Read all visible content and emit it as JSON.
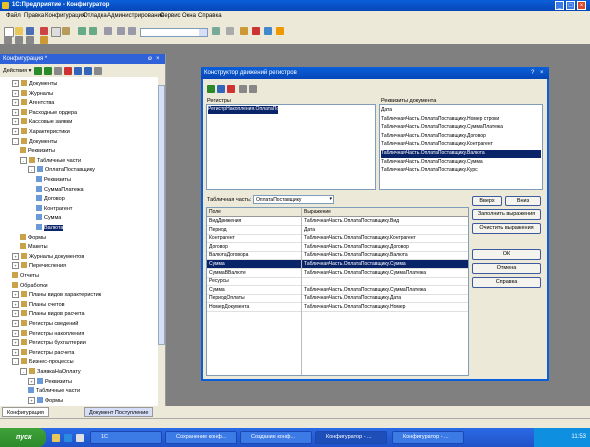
{
  "window": {
    "title": "1С:Предприятие - Конфигуратор"
  },
  "menu": [
    "Файл",
    "Правка",
    "Конфигурация",
    "Отладка",
    "Администрирование",
    "Сервис",
    "Окна",
    "Справка"
  ],
  "config_panel": {
    "title": "Конфигурация *",
    "actions_label": "Действия ▾",
    "tree": [
      {
        "label": "Документы",
        "level": 1,
        "pm": "+"
      },
      {
        "label": "Журналы",
        "level": 1,
        "pm": "+"
      },
      {
        "label": "Агентства",
        "level": 1,
        "pm": "+"
      },
      {
        "label": "Расходные ордера",
        "level": 1,
        "pm": "+"
      },
      {
        "label": "Кассовые заявки",
        "level": 1,
        "pm": "+"
      },
      {
        "label": "Характеристики",
        "level": 1,
        "pm": "+"
      },
      {
        "label": "Документы",
        "level": 1,
        "pm": "-"
      },
      {
        "label": "Реквизиты",
        "level": 2,
        "pm": ""
      },
      {
        "label": "Табличные части",
        "level": 2,
        "pm": "-"
      },
      {
        "label": "ОплатаПоставщику",
        "level": 3,
        "pm": "-"
      },
      {
        "label": "Реквизиты",
        "level": 4,
        "pm": ""
      },
      {
        "label": "СуммаПлатежа",
        "level": 4,
        "pm": ""
      },
      {
        "label": "Договор",
        "level": 4,
        "pm": ""
      },
      {
        "label": "Контрагент",
        "level": 4,
        "pm": ""
      },
      {
        "label": "Сумма",
        "level": 4,
        "pm": ""
      },
      {
        "label": "Валюта",
        "level": 4,
        "pm": "",
        "selected": true
      },
      {
        "label": "Формы",
        "level": 2,
        "pm": ""
      },
      {
        "label": "Макеты",
        "level": 2,
        "pm": ""
      },
      {
        "label": "Журналы документов",
        "level": 1,
        "pm": "+"
      },
      {
        "label": "Перечисления",
        "level": 1,
        "pm": "+"
      },
      {
        "label": "Отчеты",
        "level": 1,
        "pm": ""
      },
      {
        "label": "Обработки",
        "level": 1,
        "pm": ""
      },
      {
        "label": "Планы видов характеристик",
        "level": 1,
        "pm": "+"
      },
      {
        "label": "Планы счетов",
        "level": 1,
        "pm": "+"
      },
      {
        "label": "Планы видов расчета",
        "level": 1,
        "pm": "+"
      },
      {
        "label": "Регистры сведений",
        "level": 1,
        "pm": "+"
      },
      {
        "label": "Регистры накопления",
        "level": 1,
        "pm": "+"
      },
      {
        "label": "Регистры бухгалтерии",
        "level": 1,
        "pm": "+"
      },
      {
        "label": "Регистры расчета",
        "level": 1,
        "pm": "+"
      },
      {
        "label": "Бизнес-процессы",
        "level": 1,
        "pm": "-"
      },
      {
        "label": "ЗаявкаНаОплату",
        "level": 2,
        "pm": "-"
      },
      {
        "label": "Реквизиты",
        "level": 3,
        "pm": "+"
      },
      {
        "label": "Табличные части",
        "level": 3,
        "pm": ""
      },
      {
        "label": "Формы",
        "level": 3,
        "pm": "+"
      }
    ]
  },
  "dialog": {
    "title": "Конструктор движений регистров",
    "registers_label": "Регистры",
    "registers": [
      "РегистрНакопления.ОплатаПоставщикам"
    ],
    "doc_fields_label": "Реквизиты документа",
    "doc_fields": [
      "Дата",
      "ТабличнаяЧасть.ОплатаПоставщику.Номер строки",
      "ТабличнаяЧасть.ОплатаПоставщику.СуммаПлатежа",
      "ТабличнаяЧасть.ОплатаПоставщику.Договор",
      "ТабличнаяЧасть.ОплатаПоставщику.Контрагент",
      "ТабличнаяЧасть.ОплатаПоставщику.Валюта",
      "ТабличнаяЧасть.ОплатаПоставщику.Сумма",
      "ТабличнаяЧасть.ОплатаПоставщику.Курс"
    ],
    "doc_fields_selected": 5,
    "tablepart_label": "Табличная часть:",
    "tablepart_value": "ОплатаПоставщику",
    "btn_fill": "Заполнить выражения",
    "btn_clear": "Очистить выражения",
    "btn_up": "Вверх",
    "btn_down": "Вниз",
    "btn_ok": "ОК",
    "btn_cancel": "Отмена",
    "btn_help": "Справка",
    "grid_headers": [
      "Поле",
      "Выражение"
    ],
    "grid_rows": [
      [
        "ВидДвижения",
        "ТабличнаяЧасть.ОплатаПоставщику.Вид"
      ],
      [
        "Период",
        "Дата"
      ],
      [
        "Контрагент",
        "ТабличнаяЧасть.ОплатаПоставщику.Контрагент"
      ],
      [
        "Договор",
        "ТабличнаяЧасть.ОплатаПоставщику.Договор"
      ],
      [
        "ВалютаДоговора",
        "ТабличнаяЧасть.ОплатаПоставщику.Валюта"
      ],
      [
        "Сумма",
        "ТабличнаяЧасть.ОплатаПоставщику.Сумма"
      ],
      [
        "СуммаВВалюте",
        "ТабличнаяЧасть.ОплатаПоставщику.СуммаПлатежа"
      ],
      [
        "Ресурсы",
        ""
      ],
      [
        "Сумма",
        "ТабличнаяЧасть.ОплатаПоставщику.СуммаПлатежа"
      ],
      [
        "ПериодОплаты",
        "ТабличнаяЧасть.ОплатаПоставщику.Дата"
      ],
      [
        "НомерДокумента",
        "ТабличнаяЧасть.ОплатаПоставщику.Номер"
      ]
    ],
    "grid_selected": 5
  },
  "bottom_tabs": [
    "Конфигурация",
    "Документ Поступление"
  ],
  "taskbar": {
    "start_label": "пуск",
    "tasks": [
      "1С",
      "Сохранение конф...",
      "Создание конф...",
      "Конфигуратор - ...",
      "Конфигуратор - ..."
    ],
    "active_task": 3,
    "clock": "11:53"
  }
}
